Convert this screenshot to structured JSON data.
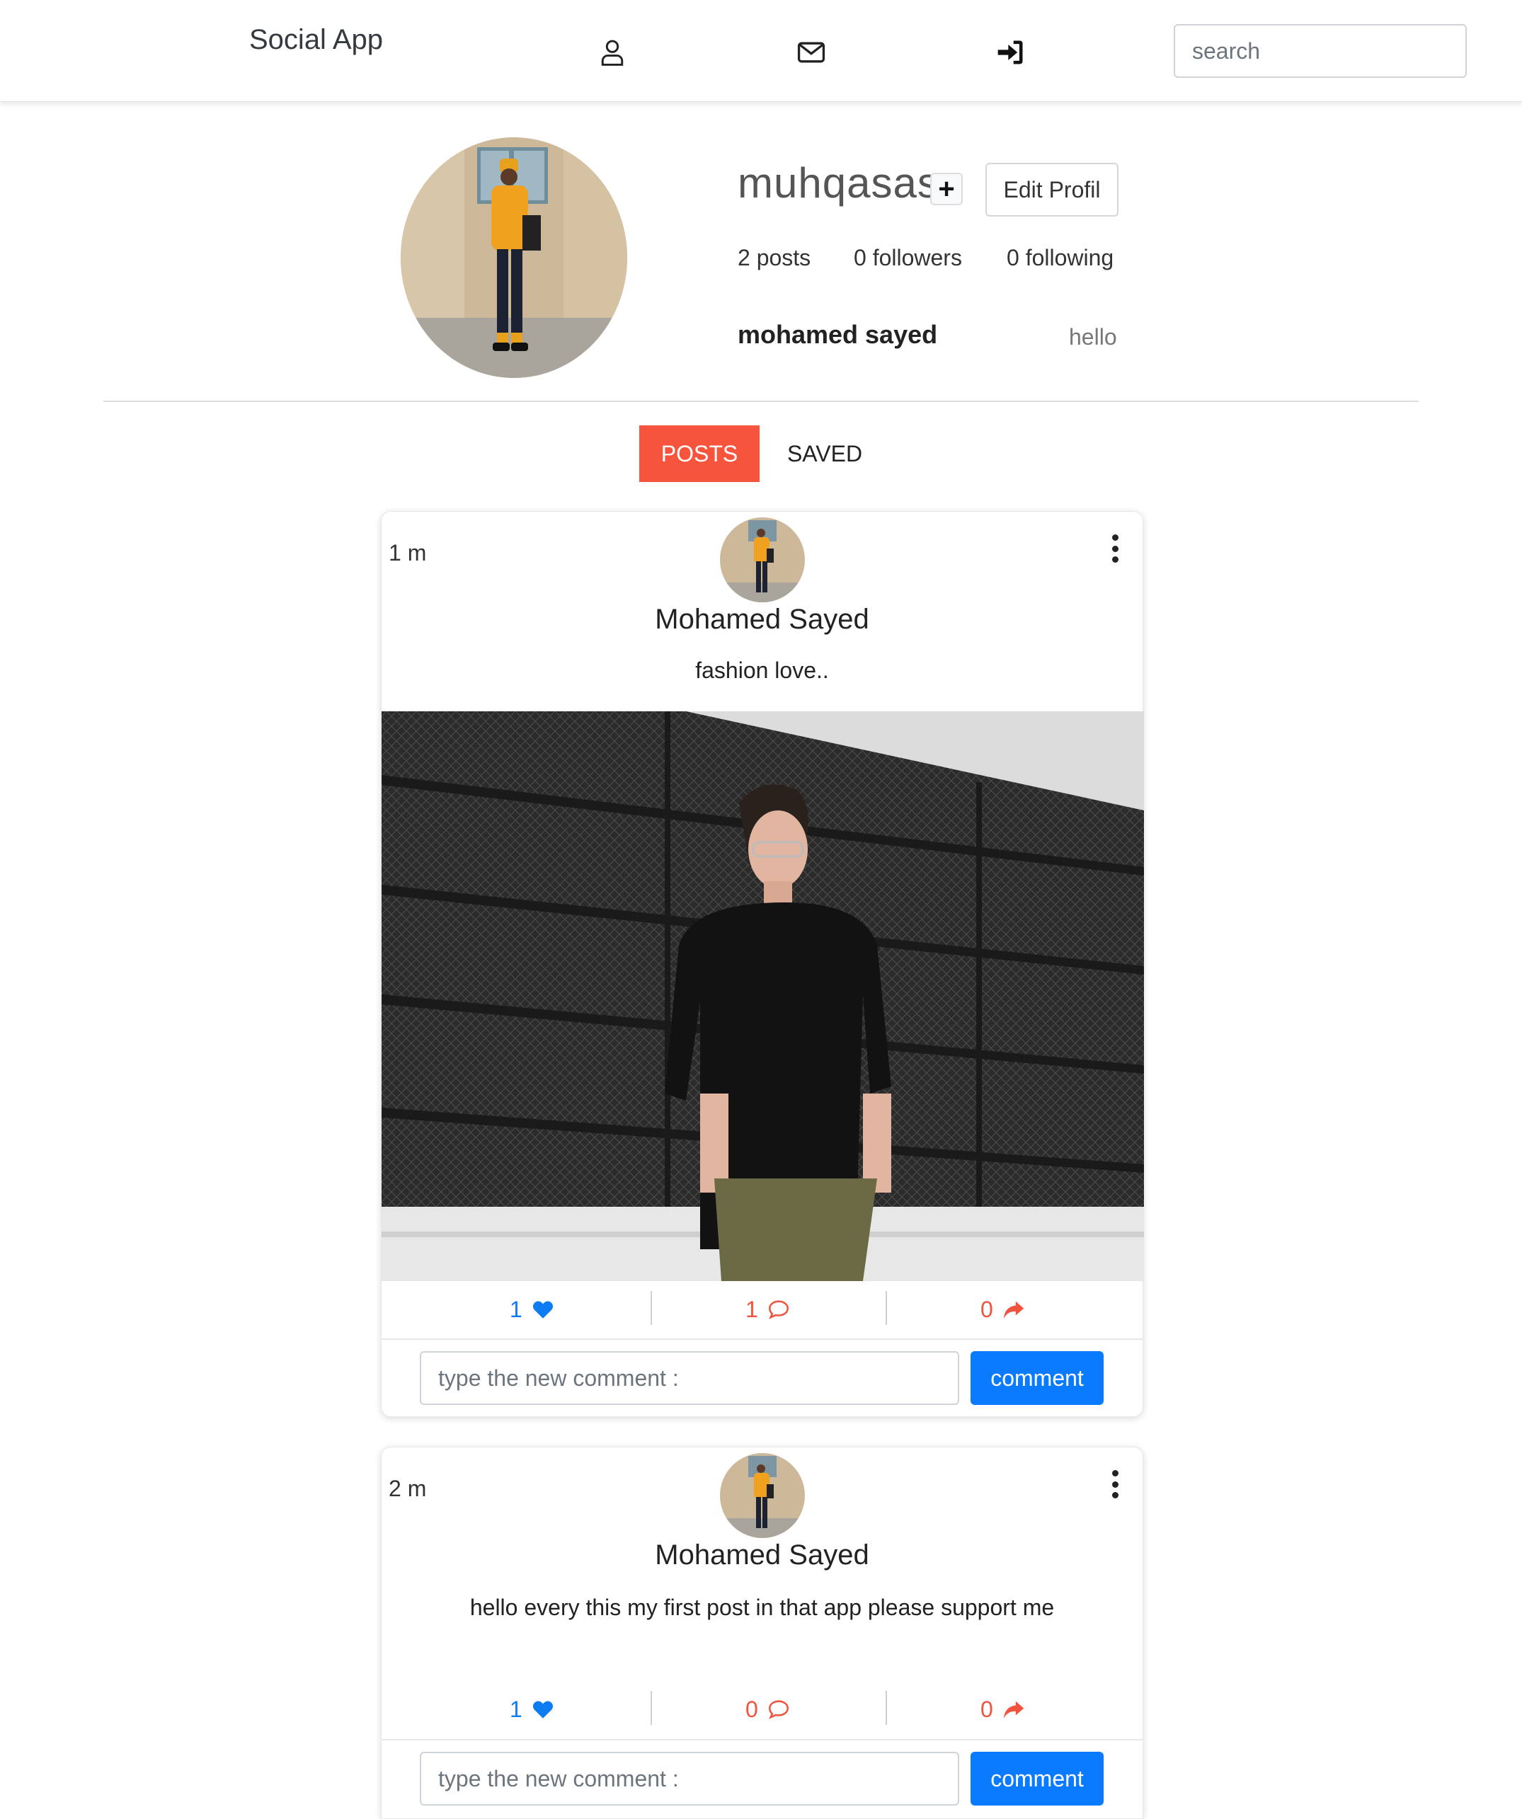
{
  "navbar": {
    "brand": "Social App",
    "icons": [
      "user-icon",
      "envelope-icon",
      "sign-in-icon"
    ],
    "search_placeholder": "search"
  },
  "profile": {
    "username": "muhqasas",
    "edit_label": "Edit Profil",
    "posts": "2 posts",
    "followers": "0 followers",
    "following": "0 following",
    "full_name": "mohamed sayed",
    "bio": "hello"
  },
  "tabs": {
    "posts": "POSTS",
    "saved": "SAVED"
  },
  "colors": {
    "accent": "#f7543e",
    "primary": "#0a7bff",
    "like": "#0d7bf2"
  },
  "posts": [
    {
      "time": "1 m",
      "author": "Mohamed Sayed",
      "text": "fashion love..",
      "likes": "1",
      "comments": "1",
      "shares": "0",
      "comment_placeholder": "type the new comment :",
      "comment_label": "comment"
    },
    {
      "time": "2 m",
      "author": "Mohamed Sayed",
      "text": "hello every this my first post in that app please support me",
      "likes": "1",
      "comments": "0",
      "shares": "0",
      "comment_placeholder": "type the new comment :",
      "comment_label": "comment"
    }
  ]
}
